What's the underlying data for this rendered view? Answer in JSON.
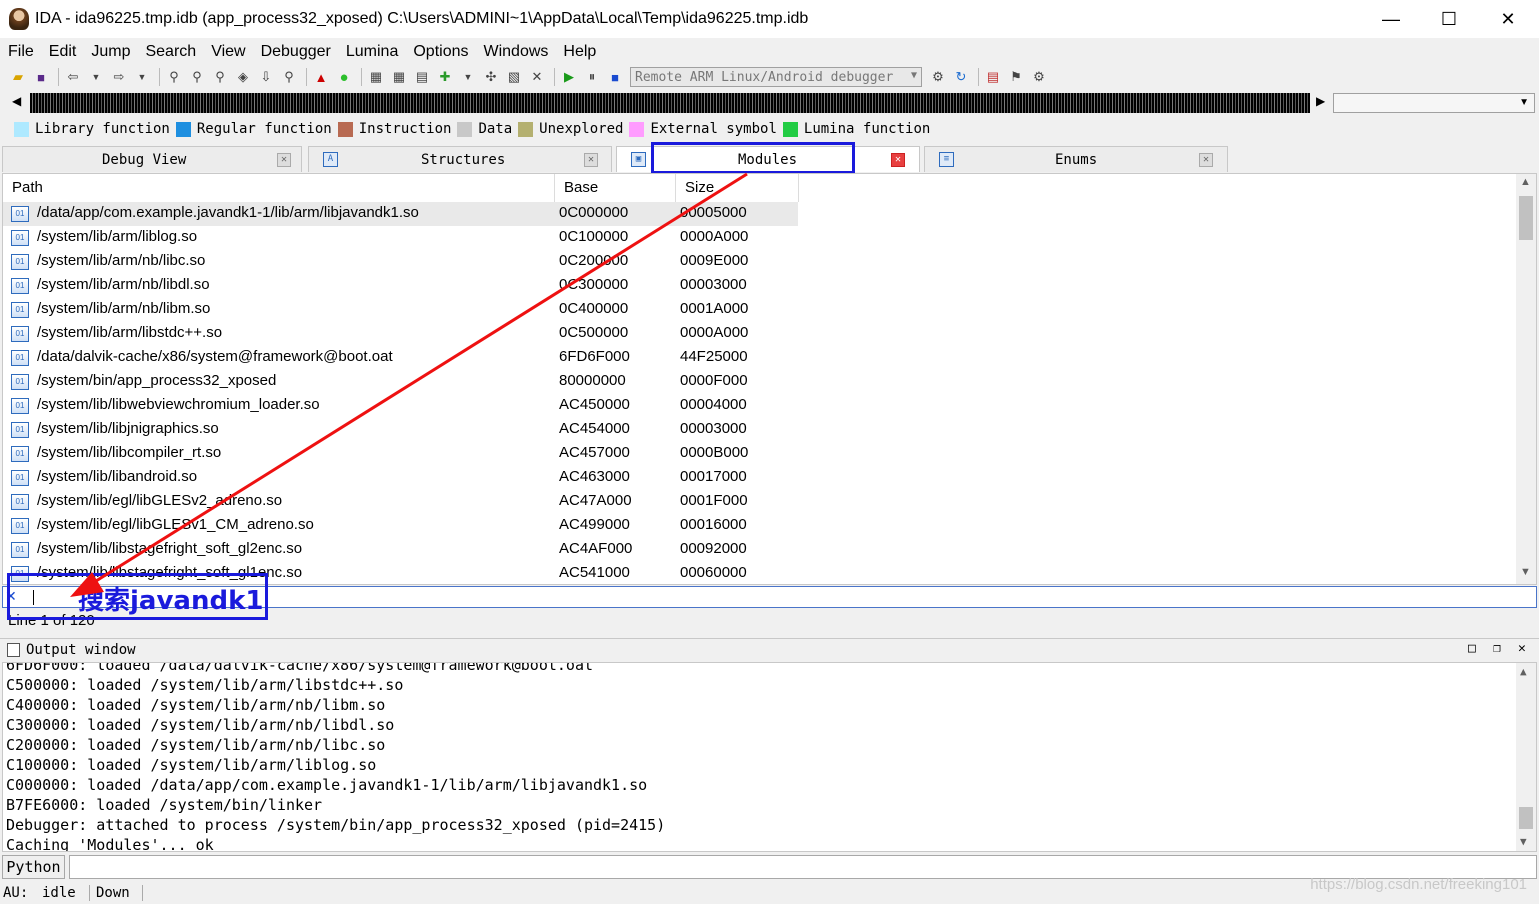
{
  "window": {
    "title": "IDA - ida96225.tmp.idb (app_process32_xposed) C:\\Users\\ADMINI~1\\AppData\\Local\\Temp\\ida96225.tmp.idb",
    "minimize": "—",
    "maximize": "☐",
    "close": "✕"
  },
  "menu": [
    "File",
    "Edit",
    "Jump",
    "Search",
    "View",
    "Debugger",
    "Lumina",
    "Options",
    "Windows",
    "Help"
  ],
  "toolbar": {
    "debugger_select": "Remote ARM Linux/Android debugger"
  },
  "legend": [
    {
      "label": "Library function",
      "color": "#aee9ff"
    },
    {
      "label": "Regular function",
      "color": "#1e8fe0"
    },
    {
      "label": "Instruction",
      "color": "#b86a52"
    },
    {
      "label": "Data",
      "color": "#c8c8c8"
    },
    {
      "label": "Unexplored",
      "color": "#b4b070"
    },
    {
      "label": "External symbol",
      "color": "#ff9cff"
    },
    {
      "label": "Lumina function",
      "color": "#22cc44"
    }
  ],
  "tabs": {
    "debug_view": "Debug View",
    "structures": "Structures",
    "modules": "Modules",
    "enums": "Enums"
  },
  "modules": {
    "columns": {
      "path": "Path",
      "base": "Base",
      "size": "Size"
    },
    "rows": [
      {
        "path": "/data/app/com.example.javandk1-1/lib/arm/libjavandk1.so",
        "base": "0C000000",
        "size": "00005000"
      },
      {
        "path": "/system/lib/arm/liblog.so",
        "base": "0C100000",
        "size": "0000A000"
      },
      {
        "path": "/system/lib/arm/nb/libc.so",
        "base": "0C200000",
        "size": "0009E000"
      },
      {
        "path": "/system/lib/arm/nb/libdl.so",
        "base": "0C300000",
        "size": "00003000"
      },
      {
        "path": "/system/lib/arm/nb/libm.so",
        "base": "0C400000",
        "size": "0001A000"
      },
      {
        "path": "/system/lib/arm/libstdc++.so",
        "base": "0C500000",
        "size": "0000A000"
      },
      {
        "path": "/data/dalvik-cache/x86/system@framework@boot.oat",
        "base": "6FD6F000",
        "size": "44F25000"
      },
      {
        "path": "/system/bin/app_process32_xposed",
        "base": "80000000",
        "size": "0000F000"
      },
      {
        "path": "/system/lib/libwebviewchromium_loader.so",
        "base": "AC450000",
        "size": "00004000"
      },
      {
        "path": "/system/lib/libjnigraphics.so",
        "base": "AC454000",
        "size": "00003000"
      },
      {
        "path": "/system/lib/libcompiler_rt.so",
        "base": "AC457000",
        "size": "0000B000"
      },
      {
        "path": "/system/lib/libandroid.so",
        "base": "AC463000",
        "size": "00017000"
      },
      {
        "path": "/system/lib/egl/libGLESv2_adreno.so",
        "base": "AC47A000",
        "size": "0001F000"
      },
      {
        "path": "/system/lib/egl/libGLESv1_CM_adreno.so",
        "base": "AC499000",
        "size": "00016000"
      },
      {
        "path": "/system/lib/libstagefright_soft_gl2enc.so",
        "base": "AC4AF000",
        "size": "00092000"
      },
      {
        "path": "/system/lib/libstagefright_soft_gl1enc.so",
        "base": "AC541000",
        "size": "00060000"
      }
    ],
    "line_count": "Line 1 of 120"
  },
  "search": {
    "annotation": "搜索javandk1",
    "value": ""
  },
  "output": {
    "title": "Output window",
    "lines": [
      "6FD6F000: loaded /data/dalvik-cache/x86/system@framework@boot.oat",
      "C500000: loaded /system/lib/arm/libstdc++.so",
      "C400000: loaded /system/lib/arm/nb/libm.so",
      "C300000: loaded /system/lib/arm/nb/libdl.so",
      "C200000: loaded /system/lib/arm/nb/libc.so",
      "C100000: loaded /system/lib/arm/liblog.so",
      "C000000: loaded /data/app/com.example.javandk1-1/lib/arm/libjavandk1.so",
      "B7FE6000: loaded /system/bin/linker",
      "Debugger: attached to process /system/bin/app_process32_xposed (pid=2415)",
      "Caching 'Modules'... ok"
    ]
  },
  "python": {
    "label": "Python"
  },
  "status": {
    "au": "AU:",
    "state": "idle",
    "direction": "Down"
  },
  "watermark": "https://blog.csdn.net/freeking101"
}
